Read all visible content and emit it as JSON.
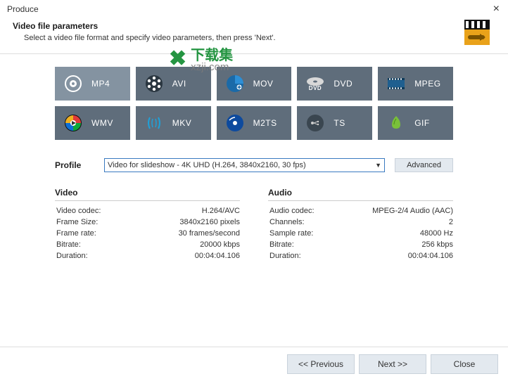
{
  "window": {
    "title": "Produce"
  },
  "header": {
    "title": "Video file parameters",
    "subtitle": "Select a video file format and specify video parameters, then press 'Next'."
  },
  "formats": [
    {
      "label": "MP4",
      "selected": true
    },
    {
      "label": "AVI"
    },
    {
      "label": "MOV"
    },
    {
      "label": "DVD"
    },
    {
      "label": "MPEG"
    },
    {
      "label": "WMV"
    },
    {
      "label": "MKV"
    },
    {
      "label": "M2TS"
    },
    {
      "label": "TS"
    },
    {
      "label": "GIF"
    }
  ],
  "profile": {
    "label": "Profile",
    "selected": "Video for slideshow - 4K UHD (H.264, 3840x2160, 30 fps)",
    "advanced": "Advanced"
  },
  "video": {
    "heading": "Video",
    "rows": [
      {
        "k": "Video codec:",
        "v": "H.264/AVC"
      },
      {
        "k": "Frame Size:",
        "v": "3840x2160 pixels"
      },
      {
        "k": "Frame rate:",
        "v": "30 frames/second"
      },
      {
        "k": "Bitrate:",
        "v": "20000 kbps"
      },
      {
        "k": "Duration:",
        "v": "00:04:04.106"
      }
    ]
  },
  "audio": {
    "heading": "Audio",
    "rows": [
      {
        "k": "Audio codec:",
        "v": "MPEG-2/4 Audio (AAC)"
      },
      {
        "k": "Channels:",
        "v": "2"
      },
      {
        "k": "Sample rate:",
        "v": "48000 Hz"
      },
      {
        "k": "Bitrate:",
        "v": "256 kbps"
      },
      {
        "k": "Duration:",
        "v": "00:04:04.106"
      }
    ]
  },
  "footer": {
    "prev": "<< Previous",
    "next": "Next >>",
    "close": "Close"
  },
  "watermark": {
    "brand": "下载集",
    "domain": "xzji.com"
  }
}
